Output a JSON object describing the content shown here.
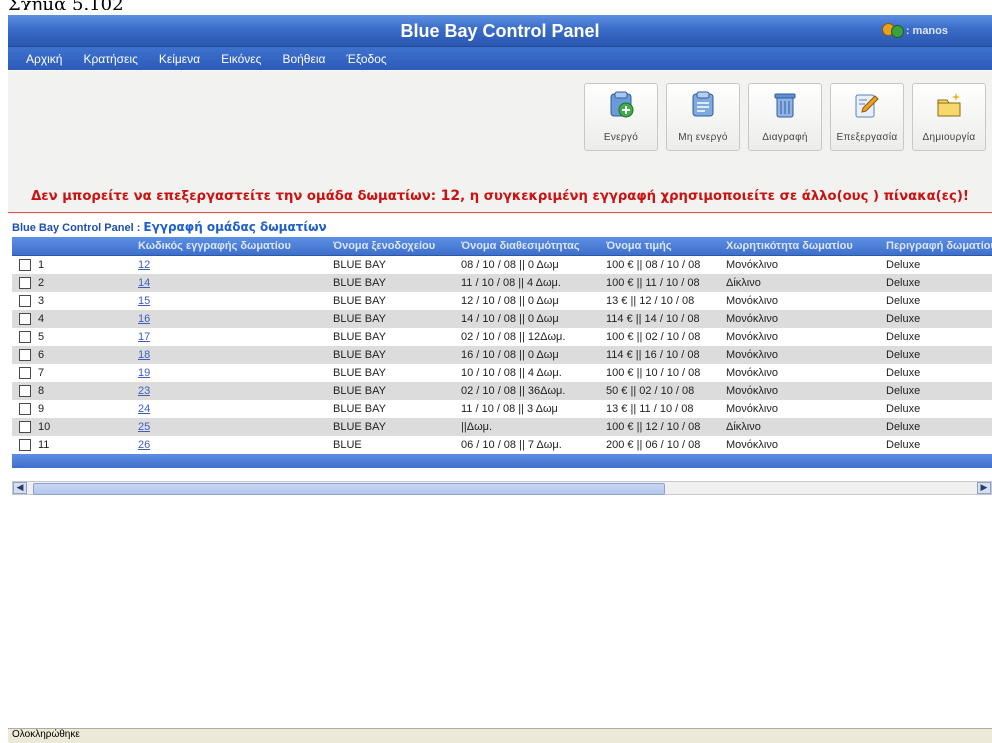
{
  "caption": "Σχήμα 5.102",
  "app": {
    "title": "Blue Bay Control Panel",
    "user": ": manos"
  },
  "menu": [
    "Αρχική",
    "Κρατήσεις",
    "Κείμενα",
    "Εικόνες",
    "Βοήθεια",
    "Έξοδος"
  ],
  "toolbar": {
    "active_label": "Ενεργό",
    "inactive_label": "Μη ενεργό",
    "delete_label": "Διαγραφή",
    "edit_label": "Επεξεργασία",
    "create_label": "Δημιουργία"
  },
  "error": {
    "prefix": "Δεν μπορείτε να επεξεργαστείτε την ομάδα δωματίων: ",
    "group_id": "12",
    "suffix": ", η συγκεκριμένη εγγραφή χρησιμοποιείτε σε άλλο(ους ) πίνακα(ες)!"
  },
  "breadcrumb": {
    "panel": "Blue Bay Control Panel :",
    "page": "Εγγραφή ομάδας δωματίων"
  },
  "table": {
    "headers": [
      "Κωδικός εγγραφής δωματίου",
      "Όνομα ξενοδοχείου",
      "Όνομα διαθεσιμότητας",
      "Όνομα τιμής",
      "Χωρητικότητα δωματίου",
      "Περιγραφή δωματίου"
    ],
    "rows": [
      {
        "n": "1",
        "code": "12",
        "hotel": "BLUE BAY",
        "avail": "08 / 10 / 08 || 0 Δωμ",
        "price": "100 € || 08 / 10 / 08",
        "cap": "Μονόκλινο",
        "desc": "Deluxe"
      },
      {
        "n": "2",
        "code": "14",
        "hotel": "BLUE BAY",
        "avail": "11 / 10 / 08 || 4 Δωμ.",
        "price": "100 € || 11 / 10 / 08",
        "cap": "Δίκλινο",
        "desc": "Deluxe"
      },
      {
        "n": "3",
        "code": "15",
        "hotel": "BLUE BAY",
        "avail": "12 / 10 / 08 || 0 Δωμ",
        "price": "13 € || 12 / 10 / 08",
        "cap": "Μονόκλινο",
        "desc": "Deluxe"
      },
      {
        "n": "4",
        "code": "16",
        "hotel": "BLUE BAY",
        "avail": "14 / 10 / 08 || 0 Δωμ",
        "price": "114 € || 14 / 10 / 08",
        "cap": "Μονόκλινο",
        "desc": "Deluxe"
      },
      {
        "n": "5",
        "code": "17",
        "hotel": "BLUE BAY",
        "avail": "02 / 10 / 08 || 12Δωμ.",
        "price": "100 € || 02 / 10 / 08",
        "cap": "Μονόκλινο",
        "desc": "Deluxe"
      },
      {
        "n": "6",
        "code": "18",
        "hotel": "BLUE BAY",
        "avail": "16 / 10 / 08 || 0 Δωμ",
        "price": "114 € || 16 / 10 / 08",
        "cap": "Μονόκλινο",
        "desc": "Deluxe"
      },
      {
        "n": "7",
        "code": "19",
        "hotel": "BLUE BAY",
        "avail": "10 / 10 / 08 || 4 Δωμ.",
        "price": "100 € || 10 / 10 / 08",
        "cap": "Μονόκλινο",
        "desc": "Deluxe"
      },
      {
        "n": "8",
        "code": "23",
        "hotel": "BLUE BAY",
        "avail": "02 / 10 / 08 || 36Δωμ.",
        "price": "50 € || 02 / 10 / 08",
        "cap": "Μονόκλινο",
        "desc": "Deluxe"
      },
      {
        "n": "9",
        "code": "24",
        "hotel": "BLUE BAY",
        "avail": "11 / 10 / 08 || 3 Δωμ",
        "price": "13 € || 11 / 10 / 08",
        "cap": "Μονόκλινο",
        "desc": "Deluxe"
      },
      {
        "n": "10",
        "code": "25",
        "hotel": "BLUE BAY",
        "avail": "||Δωμ.",
        "price": "100 € || 12 / 10 / 08",
        "cap": "Δίκλινο",
        "desc": "Deluxe"
      },
      {
        "n": "11",
        "code": "26",
        "hotel": "BLUE",
        "avail": "06 / 10 / 08 || 7 Δωμ.",
        "price": "200 € || 06 / 10 / 08",
        "cap": "Μονόκλινο",
        "desc": "Deluxe"
      }
    ]
  },
  "status": "Ολοκληρώθηκε",
  "colors": {
    "header_blue": "#3e6fcb",
    "error_red": "#cc1111",
    "row_alt": "#dcdcdc"
  }
}
